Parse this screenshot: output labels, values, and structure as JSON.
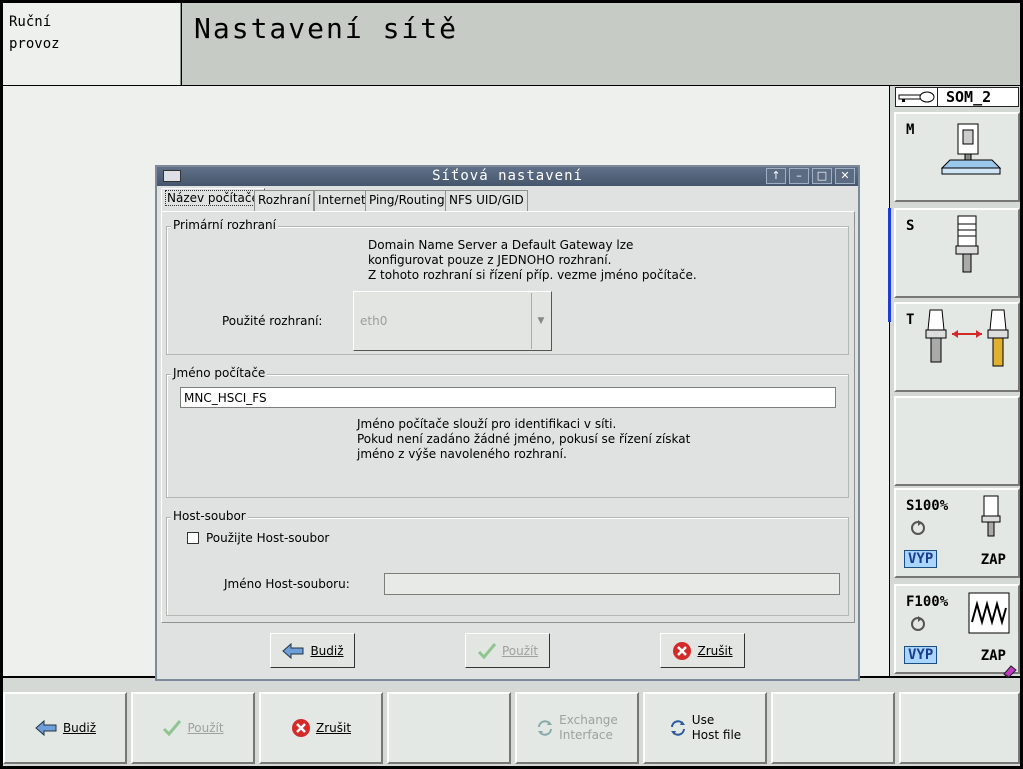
{
  "header": {
    "mode_line1": "Ruční",
    "mode_line2": "provoz",
    "title": "Nastavení sítě"
  },
  "right_panel": {
    "key_name": "SOM_2",
    "softkeys": [
      {
        "letter": "M"
      },
      {
        "letter": "S"
      },
      {
        "letter": "T"
      },
      {
        "letter": ""
      },
      {
        "label": "S100%",
        "off": "VYP",
        "on": "ZAP"
      },
      {
        "label": "F100%",
        "off": "VYP",
        "on": "ZAP"
      }
    ]
  },
  "dialog": {
    "title": "Síťová nastavení",
    "tabs": [
      "Název počítače",
      "Rozhraní",
      "Internet",
      "Ping/Routing",
      "NFS UID/GID"
    ],
    "active_tab": "Název počítače",
    "primary": {
      "group_title": "Primární rozhraní",
      "info_lines": [
        "Domain Name Server a Default Gateway  lze",
        "konfigurovat pouze z JEDNOHO  rozhraní.",
        "Z tohoto rozhraní si řízení příp. vezme jméno počítače."
      ],
      "interface_label": "Použité rozhraní:",
      "interface_value": "eth0"
    },
    "hostname": {
      "group_title": "Jméno počítače",
      "value": "MNC_HSCI_FS",
      "info_lines": [
        "Jméno počítače slouží pro identifikaci v síti.",
        "Pokud není zadáno žádné jméno, pokusí se řízení získat",
        "jméno z výše navoleného rozhraní."
      ]
    },
    "hostfile": {
      "group_title": "Host-soubor",
      "checkbox_label": "Použijte Host-soubor",
      "checked": false,
      "file_label": "Jméno Host-souboru:",
      "file_value": ""
    },
    "buttons": {
      "ok": "Budiž",
      "apply": "Použít",
      "cancel": "Zrušit"
    }
  },
  "softkeys_bottom": {
    "ok": "Budiž",
    "apply": "Použít",
    "cancel": "Zrušit",
    "exchange_line1": "Exchange",
    "exchange_line2": "Interface",
    "hostfile_line1": "Use",
    "hostfile_line2": "Host file"
  },
  "colors": {
    "accent_blue": "#1e3dd6",
    "title_bar": "#46566d",
    "vyp_badge": "#a9d5ff",
    "cancel_red": "#d42a2a"
  }
}
